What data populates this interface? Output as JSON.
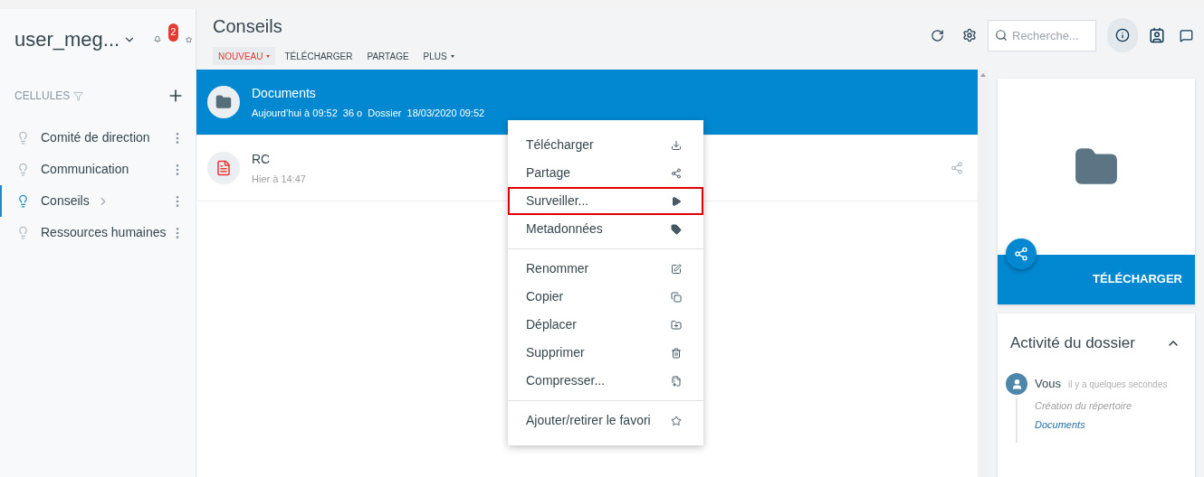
{
  "user": {
    "name": "user_meg...",
    "notifications": "2"
  },
  "sidebar": {
    "section": "CELLULES",
    "items": [
      {
        "label": "Comité de direction",
        "selected": false
      },
      {
        "label": "Communication",
        "selected": false
      },
      {
        "label": "Conseils",
        "selected": true
      },
      {
        "label": "Ressources humaines",
        "selected": false
      }
    ]
  },
  "header": {
    "title": "Conseils",
    "toolbar": [
      {
        "label": "NOUVEAU",
        "selected": true,
        "dropdown": true
      },
      {
        "label": "TÉLÉCHARGER",
        "selected": false,
        "dropdown": false
      },
      {
        "label": "PARTAGE",
        "selected": false,
        "dropdown": false
      },
      {
        "label": "PLUS",
        "selected": false,
        "dropdown": true
      }
    ],
    "search": {
      "placeholder": "Recherche..."
    }
  },
  "files": [
    {
      "name": "Documents",
      "kind": "folder",
      "selected": true,
      "shared": false,
      "details": [
        "Aujourd’hui à 09:52",
        "36 o",
        "Dossier",
        "18/03/2020 09:52"
      ]
    },
    {
      "name": "RC",
      "kind": "pdf",
      "selected": false,
      "shared": true,
      "details": [
        "Hier à 14:47"
      ]
    }
  ],
  "context_menu": {
    "groups": [
      [
        {
          "label": "Télécharger",
          "highlighted": false
        },
        {
          "label": "Partage",
          "highlighted": false
        },
        {
          "label": "Surveiller...",
          "highlighted": true
        },
        {
          "label": "Metadonnées",
          "highlighted": false
        }
      ],
      [
        {
          "label": "Renommer",
          "highlighted": false
        },
        {
          "label": "Copier",
          "highlighted": false
        },
        {
          "label": "Déplacer",
          "highlighted": false
        },
        {
          "label": "Supprimer",
          "highlighted": false
        },
        {
          "label": "Compresser...",
          "highlighted": false
        }
      ],
      [
        {
          "label": "Ajouter/retirer le favori",
          "highlighted": false
        }
      ]
    ]
  },
  "preview": {
    "action": "TÉLÉCHARGER"
  },
  "activity": {
    "title": "Activité du dossier",
    "expanded": true,
    "entries": [
      {
        "author": "Vous",
        "time": "il y a quelques secondes",
        "action": "Création du répertoire",
        "target": "Documents"
      }
    ]
  }
}
